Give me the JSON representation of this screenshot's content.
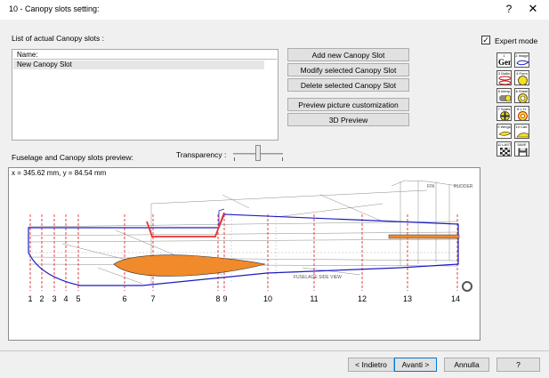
{
  "window": {
    "title": "10 - Canopy slots setting:",
    "help_label": "?",
    "close_label": "✕"
  },
  "list": {
    "label": "List of actual Canopy slots  :",
    "column_header": "Name:",
    "items": [
      "New Canopy Slot"
    ]
  },
  "buttons": {
    "add": "Add new Canopy Slot",
    "modify": "Modify selected Canopy Slot",
    "delete": "Delete selected Canopy Slot",
    "preview_custom": "Preview picture customization",
    "preview_3d": "3D Preview"
  },
  "preview": {
    "label": "Fuselage and Canopy slots preview:",
    "transparency_label": "Transparency :",
    "coord_text": "x = 345.62 mm, y = 84.54 mm",
    "station_labels": [
      "1",
      "2",
      "3",
      "4",
      "5",
      "6",
      "7",
      "8",
      "9",
      "10",
      "11",
      "12",
      "13",
      "14"
    ],
    "drawing_texts": [
      "FIN",
      "RUDDER",
      "FUSELAGE  SIDE  VIEW"
    ]
  },
  "expert_mode": {
    "label": "Expert mode",
    "checked_mark": "✓"
  },
  "toolbar": {
    "items": [
      {
        "caption": "1",
        "label": "Gen"
      },
      {
        "caption": "2 Image",
        "label": ""
      },
      {
        "caption": "3 Outlin",
        "label": ""
      },
      {
        "caption": "4 Form",
        "label": ""
      },
      {
        "caption": "5 Interp",
        "label": ""
      },
      {
        "caption": "6 Sheet",
        "label": ""
      },
      {
        "caption": "7 Spars",
        "label": ""
      },
      {
        "caption": "8 L.H.",
        "label": ""
      },
      {
        "caption": "9 Wings",
        "label": ""
      },
      {
        "caption": "10 Can.",
        "label": ""
      },
      {
        "caption": "11 LAST",
        "label": ""
      },
      {
        "caption": "SAVE",
        "label": ""
      }
    ]
  },
  "footer": {
    "back": "< Indietro",
    "next": "Avanti >",
    "cancel": "Annulla",
    "help": "?"
  },
  "colors": {
    "fuselage_outline": "#1c1cc0",
    "canopy_slot": "#e8332e",
    "wing_fill": "#f08a2a",
    "station_line": "#e03030"
  }
}
